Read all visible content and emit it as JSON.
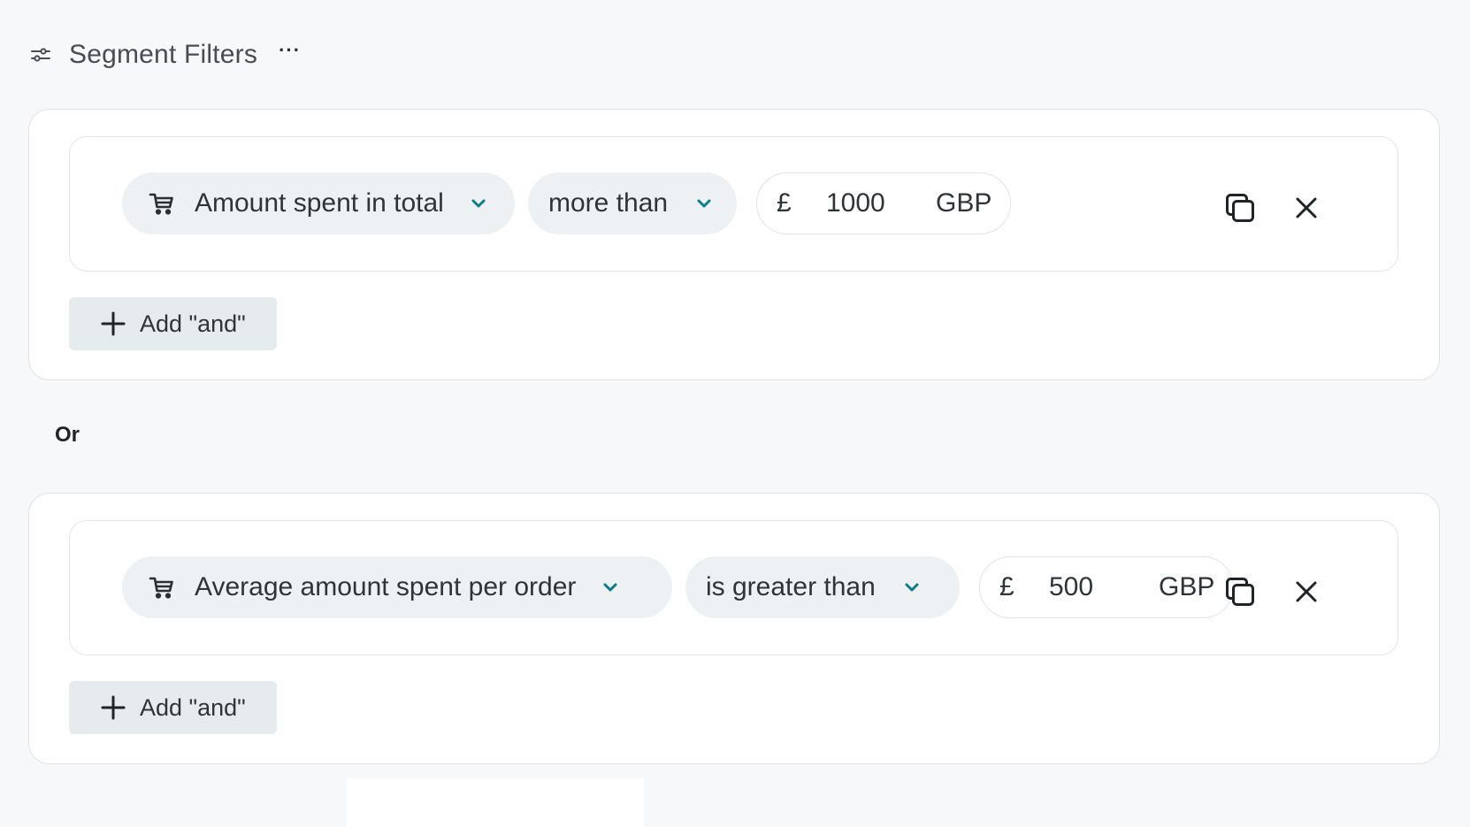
{
  "header": {
    "title": "Segment Filters",
    "more_label": "···"
  },
  "groups": [
    {
      "field_label": "Amount spent in total",
      "operator_label": "more than",
      "currency_symbol": "£",
      "amount": "1000",
      "unit": "GBP",
      "add_and_label": "Add \"and\""
    },
    {
      "field_label": "Average amount spent per order",
      "operator_label": "is greater than",
      "currency_symbol": "£",
      "amount": "500",
      "unit": "GBP",
      "add_and_label": "Add \"and\""
    }
  ],
  "or_label": "Or",
  "colors": {
    "accent_chevron": "#0f7c8a",
    "pill_bg": "#eef1f3",
    "button_bg": "#e6ebee"
  },
  "icons": {
    "header": "filters-sliders-icon",
    "field": "shopping-cart-icon",
    "operator": "chevron-down-icon",
    "duplicate": "duplicate-icon",
    "remove": "close-icon",
    "add": "plus-icon"
  }
}
